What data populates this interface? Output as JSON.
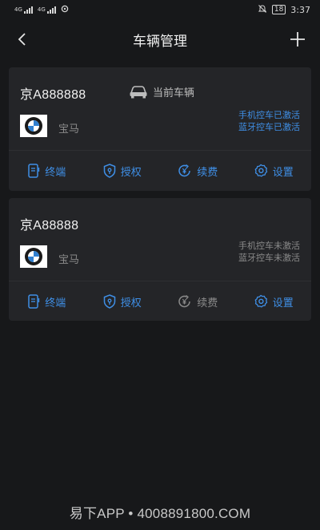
{
  "status_bar": {
    "left_texts": [
      "4G",
      "4G"
    ],
    "battery": "18",
    "time": "3:37"
  },
  "nav": {
    "title": "车辆管理"
  },
  "vehicles": [
    {
      "plate": "京A888888",
      "current_label": "当前车辆",
      "brand": "宝马",
      "status_lines": [
        "手机控车已激活",
        "蓝牙控车已激活"
      ],
      "actions": {
        "terminal": "终端",
        "authorize": "授权",
        "renew": "续费",
        "settings": "设置"
      }
    },
    {
      "plate": "京A88888",
      "brand": "宝马",
      "status_lines": [
        "手机控车未激活",
        "蓝牙控车未激活"
      ],
      "actions": {
        "terminal": "终端",
        "authorize": "授权",
        "renew": "续费",
        "settings": "设置"
      }
    }
  ],
  "colors": {
    "accent": "#3f8fe6",
    "muted": "#8a8a8a",
    "background": "#17181a",
    "card": "#242528"
  },
  "watermark": "易下APP • 4008891800.COM"
}
